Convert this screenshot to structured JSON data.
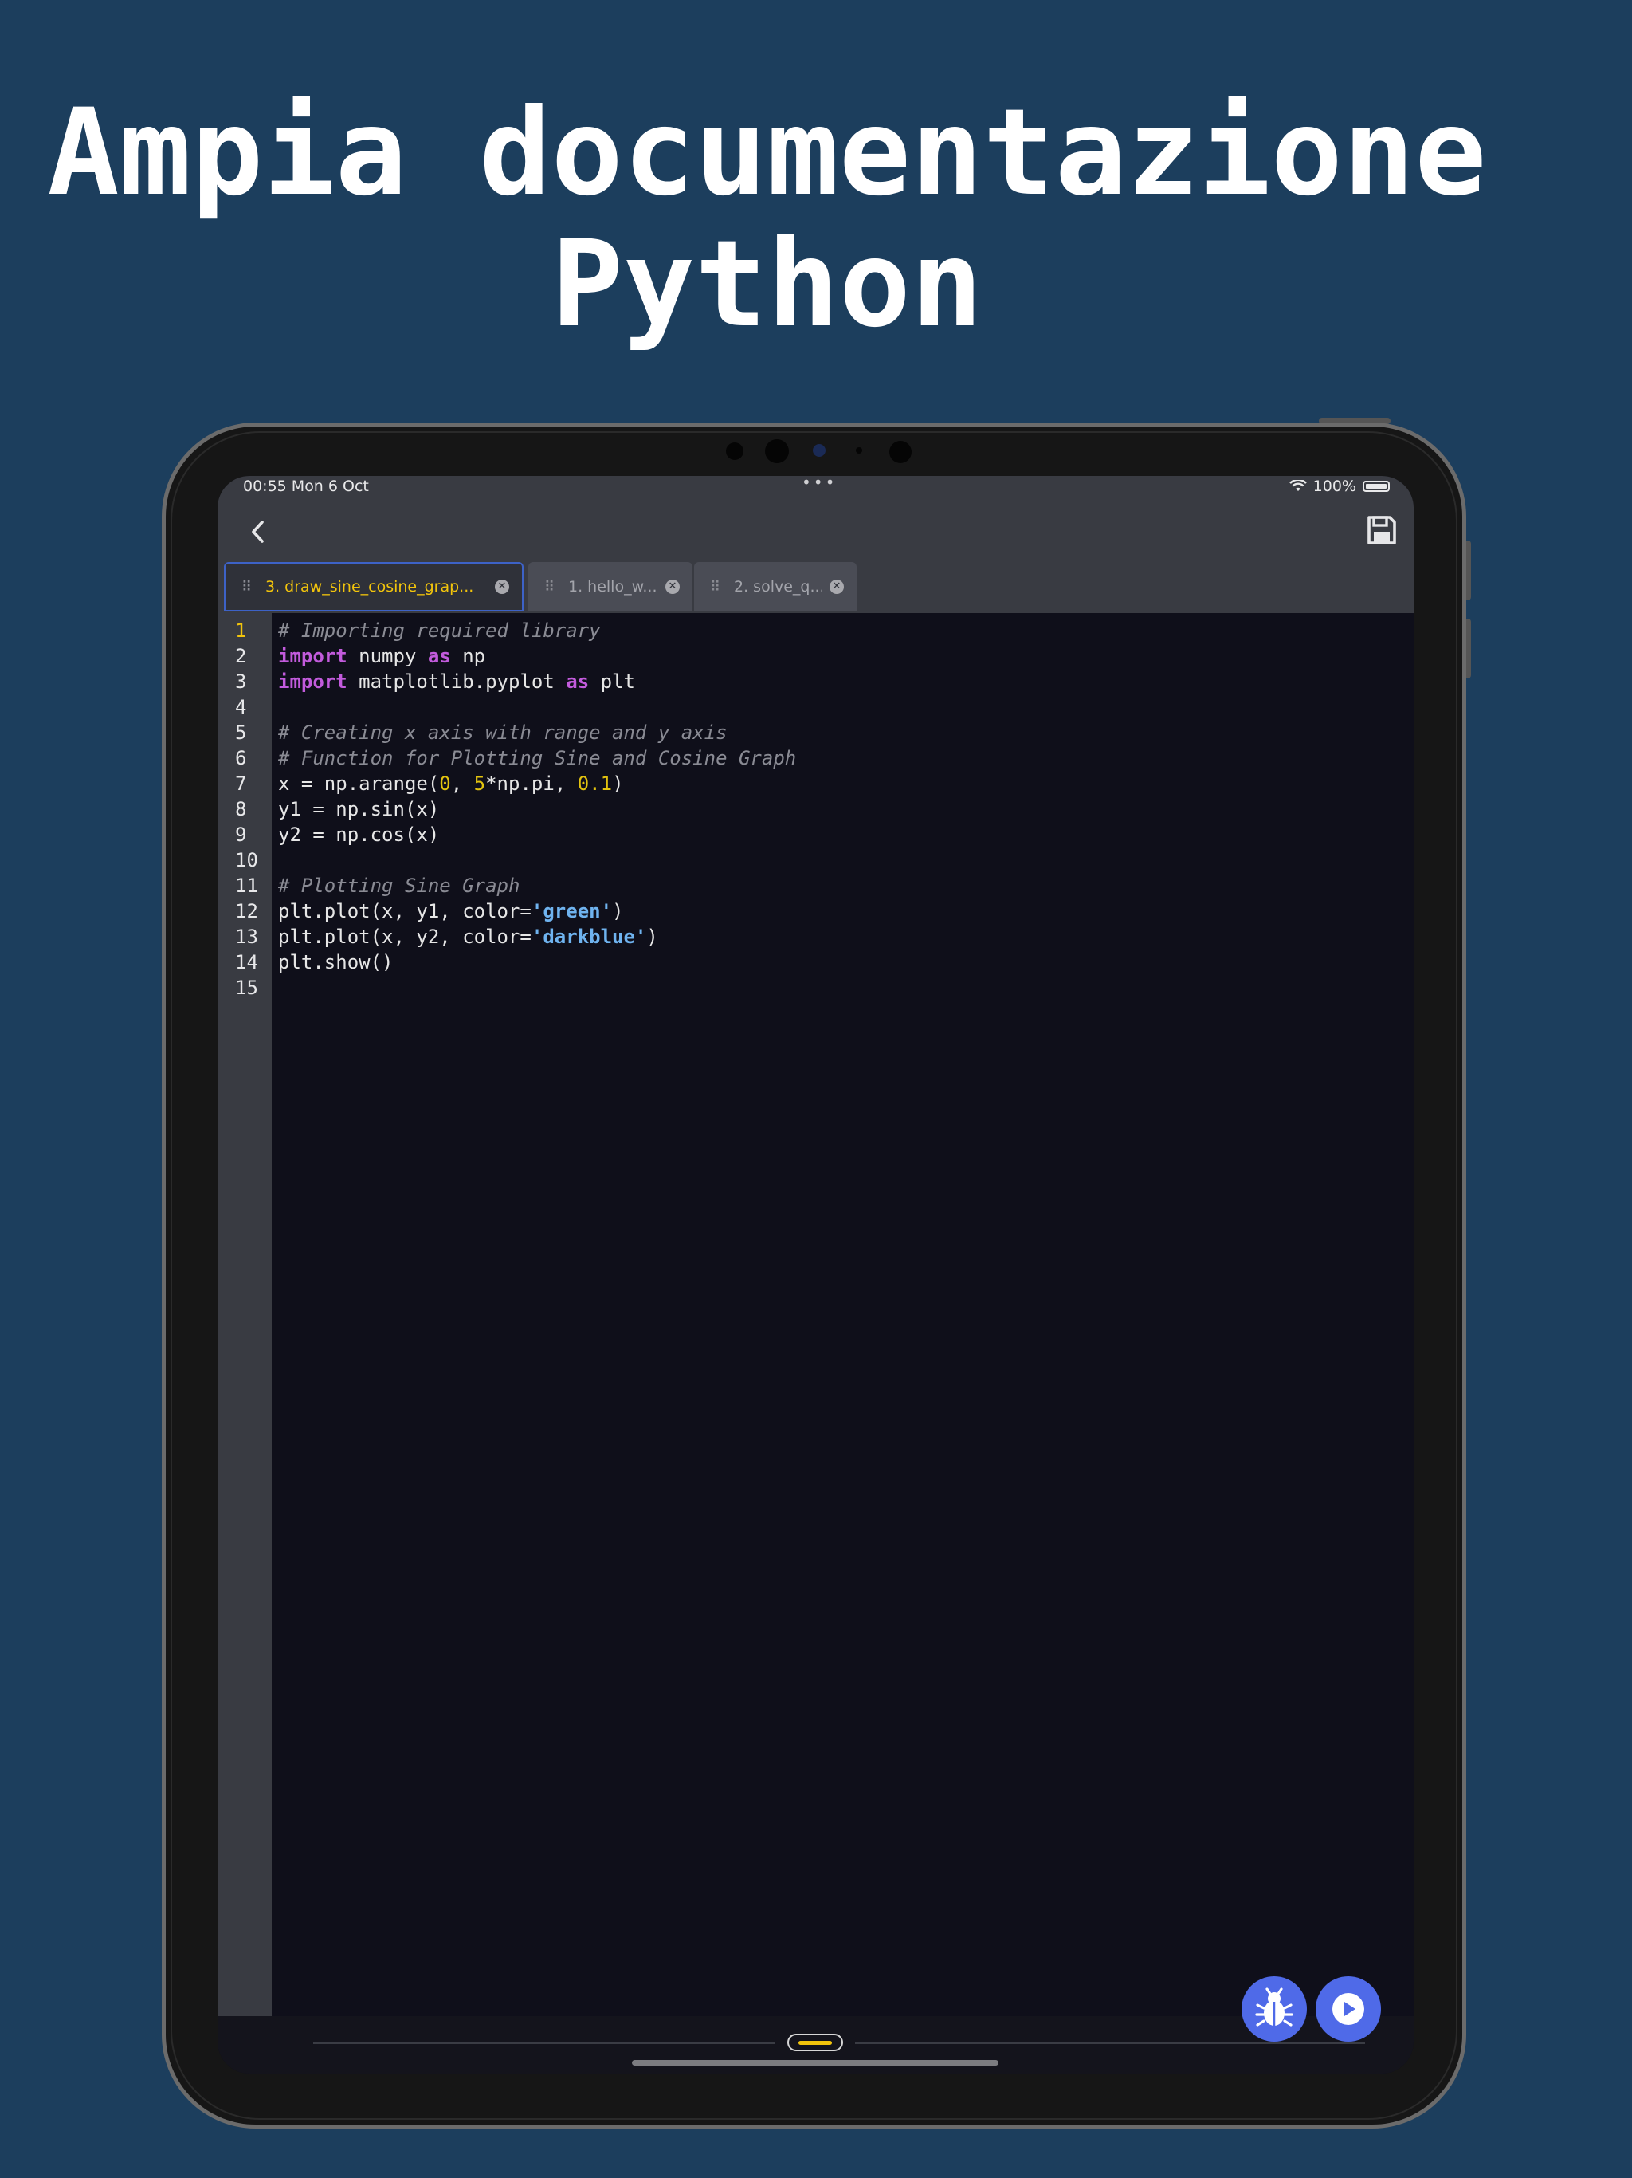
{
  "headline": {
    "line1": "Ampia documentazione",
    "line2": "Python"
  },
  "status_bar": {
    "time": "00:55  Mon 6 Oct",
    "dots": "•••",
    "battery": "100%"
  },
  "tabs": [
    {
      "label": "3. draw_sine_cosine_grap...",
      "active": true
    },
    {
      "label": "1. hello_w...",
      "active": false
    },
    {
      "label": "2. solve_q...",
      "active": false
    }
  ],
  "editor": {
    "line_numbers": [
      "1",
      "2",
      "3",
      "4",
      "5",
      "6",
      "7",
      "8",
      "9",
      "10",
      "11",
      "12",
      "13",
      "14",
      "15"
    ],
    "lines": [
      [
        {
          "t": "# Importing required library",
          "c": "cm"
        }
      ],
      [
        {
          "t": "import",
          "c": "kw"
        },
        {
          "t": " numpy ",
          "c": ""
        },
        {
          "t": "as",
          "c": "kw"
        },
        {
          "t": " np",
          "c": ""
        }
      ],
      [
        {
          "t": "import",
          "c": "kw"
        },
        {
          "t": " matplotlib.pyplot ",
          "c": ""
        },
        {
          "t": "as",
          "c": "kw"
        },
        {
          "t": " plt",
          "c": ""
        }
      ],
      [],
      [
        {
          "t": "# Creating x axis with range and y axis",
          "c": "cm"
        }
      ],
      [
        {
          "t": "# Function for Plotting Sine and Cosine Graph",
          "c": "cm"
        }
      ],
      [
        {
          "t": "x = np.arange(",
          "c": ""
        },
        {
          "t": "0",
          "c": "nu"
        },
        {
          "t": ", ",
          "c": ""
        },
        {
          "t": "5",
          "c": "nu"
        },
        {
          "t": "*np.pi, ",
          "c": ""
        },
        {
          "t": "0.1",
          "c": "nu"
        },
        {
          "t": ")",
          "c": ""
        }
      ],
      [
        {
          "t": "y1 = np.sin(x)",
          "c": ""
        }
      ],
      [
        {
          "t": "y2 = np.cos(x)",
          "c": ""
        }
      ],
      [],
      [
        {
          "t": "# Plotting Sine Graph",
          "c": "cm"
        }
      ],
      [
        {
          "t": "plt.plot(x, y1, color=",
          "c": ""
        },
        {
          "t": "'green'",
          "c": "st"
        },
        {
          "t": ")",
          "c": ""
        }
      ],
      [
        {
          "t": "plt.plot(x, y2, color=",
          "c": ""
        },
        {
          "t": "'darkblue'",
          "c": "st"
        },
        {
          "t": ")",
          "c": ""
        }
      ],
      [
        {
          "t": "plt.show()",
          "c": ""
        }
      ],
      []
    ]
  },
  "icons": {
    "back": "chevron-left-icon",
    "save": "floppy-disk-icon",
    "debug": "bug-icon",
    "run": "play-circle-icon"
  },
  "colors": {
    "background": "#1c3e5d",
    "accent": "#4f6ae8",
    "active_tab_text": "#f2c40c"
  }
}
